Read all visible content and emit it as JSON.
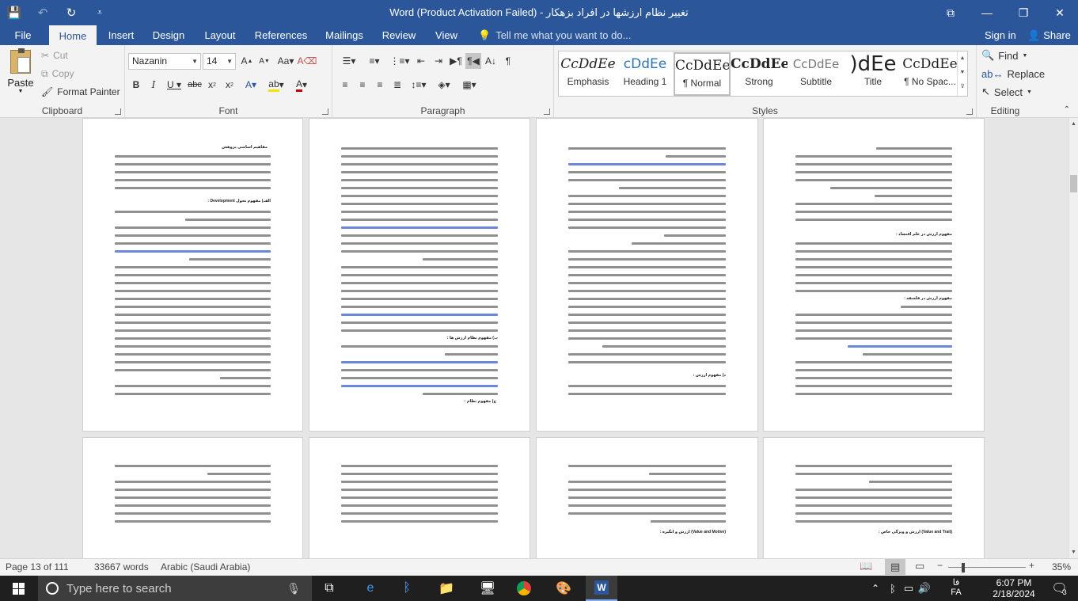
{
  "window": {
    "title": "Word (Product Activation Failed) - تغییر نظام ارزشها در افراد بزهکار",
    "controls": [
      "⧉",
      "—",
      "❐",
      "✕"
    ]
  },
  "quick_access": {
    "icons": [
      "save-icon",
      "undo-icon",
      "redo-icon",
      "customize-icon"
    ],
    "glyphs": [
      "💾",
      "↶",
      "↻",
      "⩡"
    ]
  },
  "tabs": [
    "File",
    "Home",
    "Insert",
    "Design",
    "Layout",
    "References",
    "Mailings",
    "Review",
    "View"
  ],
  "active_tab": "Home",
  "tell_me": {
    "placeholder": "Tell me what you want to do..."
  },
  "account": {
    "sign_in": "Sign in",
    "share": "Share"
  },
  "clipboard": {
    "paste": "Paste",
    "cut": "Cut",
    "copy": "Copy",
    "format_painter": "Format Painter",
    "label": "Clipboard"
  },
  "font": {
    "name": "Nazanin",
    "size": "14",
    "label": "Font",
    "accent_highlight": "#f5e400",
    "accent_color": "#c00000"
  },
  "paragraph": {
    "label": "Paragraph"
  },
  "styles": {
    "label": "Styles",
    "items": [
      {
        "preview": "CcDdEe",
        "name": "Emphasis"
      },
      {
        "preview": "cDdEe",
        "name": "Heading 1"
      },
      {
        "preview": "CcDdEe",
        "name": "¶ Normal"
      },
      {
        "preview": "CcDdEe",
        "name": "Strong"
      },
      {
        "preview": "CcDdEe",
        "name": "Subtitle"
      },
      {
        "preview": ")dEe",
        "name": "Title"
      },
      {
        "preview": "CcDdEe",
        "name": "¶ No Spac..."
      }
    ]
  },
  "editing": {
    "find": "Find",
    "replace": "Replace",
    "select": "Select",
    "label": "Editing"
  },
  "pages": {
    "p1_heading": "مفاهیم اساسی پژوهش",
    "p1_sub": "الف) مفهوم تحول Development :",
    "p2_sub": "ب) مفهوم نظام ارزش ها :",
    "p2_sub2": "ج) مفهوم نظام :",
    "p3_sub": "د) مفهوم ارزش :",
    "p4_sub": "مفهوم ارزش در علم اقتصاد :",
    "p4_sub2": "مفهوم ارزش در فلسفه :",
    "p7_sub": "(Value and Motive) ارزش و انگیزه :",
    "p8_sub": "(Value and Trait) ارزش و ویژگی خاص :"
  },
  "status": {
    "page": "Page 13 of 111",
    "words": "33667 words",
    "language": "Arabic (Saudi Arabia)",
    "zoom": "35%"
  },
  "taskbar": {
    "search_placeholder": "Type here to search",
    "lang": "فا",
    "lang2": "FA",
    "time": "6:07 PM",
    "date": "2/18/2024",
    "notif": "3"
  }
}
